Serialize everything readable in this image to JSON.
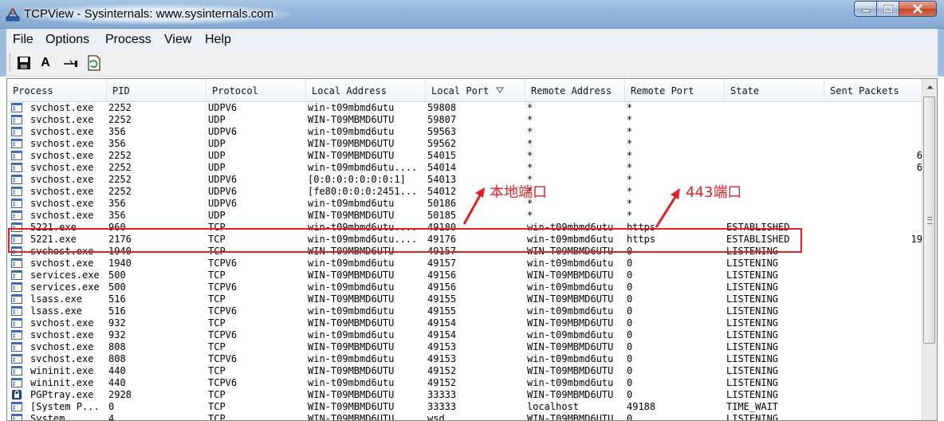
{
  "window": {
    "title": "TCPView - Sysinternals: www.sysinternals.com"
  },
  "menu": [
    "File",
    "Options",
    "Process",
    "View",
    "Help"
  ],
  "toolbar": {
    "icons": [
      "save-icon",
      "font-icon",
      "connect-icon",
      "refresh-icon"
    ],
    "font_label": "A"
  },
  "table": {
    "columns": [
      "Process",
      "PID",
      "Protocol",
      "Local Address",
      "Local Port",
      "Remote Address",
      "Remote Port",
      "State",
      "Sent Packets"
    ],
    "sort_column": "Local Port",
    "rows": [
      {
        "icon": "svc",
        "process": "svchost.exe",
        "pid": "2252",
        "protocol": "UDPV6",
        "local_address": "win-t09mbmd6utu",
        "local_port": "59808",
        "remote_address": "*",
        "remote_port": "*",
        "state": "",
        "sent": ""
      },
      {
        "icon": "svc",
        "process": "svchost.exe",
        "pid": "2252",
        "protocol": "UDP",
        "local_address": "WIN-T09MBMD6UTU",
        "local_port": "59807",
        "remote_address": "*",
        "remote_port": "*",
        "state": "",
        "sent": ""
      },
      {
        "icon": "svc",
        "process": "svchost.exe",
        "pid": "356",
        "protocol": "UDPV6",
        "local_address": "win-t09mbmd6utu",
        "local_port": "59563",
        "remote_address": "*",
        "remote_port": "*",
        "state": "",
        "sent": ""
      },
      {
        "icon": "svc",
        "process": "svchost.exe",
        "pid": "356",
        "protocol": "UDP",
        "local_address": "WIN-T09MBMD6UTU",
        "local_port": "59562",
        "remote_address": "*",
        "remote_port": "*",
        "state": "",
        "sent": ""
      },
      {
        "icon": "svc",
        "process": "svchost.exe",
        "pid": "2252",
        "protocol": "UDP",
        "local_address": "WIN-T09MBMD6UTU",
        "local_port": "54015",
        "remote_address": "*",
        "remote_port": "*",
        "state": "",
        "sent": "6"
      },
      {
        "icon": "svc",
        "process": "svchost.exe",
        "pid": "2252",
        "protocol": "UDP",
        "local_address": "win-t09mbmd6utu....",
        "local_port": "54014",
        "remote_address": "*",
        "remote_port": "*",
        "state": "",
        "sent": "6"
      },
      {
        "icon": "svc",
        "process": "svchost.exe",
        "pid": "2252",
        "protocol": "UDPV6",
        "local_address": "[0:0:0:0:0:0:0:1]",
        "local_port": "54013",
        "remote_address": "*",
        "remote_port": "*",
        "state": "",
        "sent": ""
      },
      {
        "icon": "svc",
        "process": "svchost.exe",
        "pid": "2252",
        "protocol": "UDPV6",
        "local_address": "[fe80:0:0:0:2451...",
        "local_port": "54012",
        "remote_address": "*",
        "remote_port": "*",
        "state": "",
        "sent": ""
      },
      {
        "icon": "svc",
        "process": "svchost.exe",
        "pid": "356",
        "protocol": "UDPV6",
        "local_address": "win-t09mbmd6utu",
        "local_port": "50186",
        "remote_address": "*",
        "remote_port": "*",
        "state": "",
        "sent": ""
      },
      {
        "icon": "svc",
        "process": "svchost.exe",
        "pid": "356",
        "protocol": "UDP",
        "local_address": "WIN-T09MBMD6UTU",
        "local_port": "50185",
        "remote_address": "*",
        "remote_port": "*",
        "state": "",
        "sent": ""
      },
      {
        "icon": "svc",
        "process": "5221.exe",
        "pid": "960",
        "protocol": "TCP",
        "local_address": "win-t09mbmd6utu....",
        "local_port": "49180",
        "remote_address": "win-t09mbmd6utu",
        "remote_port": "https",
        "state": "ESTABLISHED",
        "sent": ""
      },
      {
        "icon": "svc",
        "process": "5221.exe",
        "pid": "2176",
        "protocol": "TCP",
        "local_address": "win-t09mbmd6utu....",
        "local_port": "49176",
        "remote_address": "win-t09mbmd6utu",
        "remote_port": "https",
        "state": "ESTABLISHED",
        "sent": "19"
      },
      {
        "icon": "svc",
        "process": "svchost.exe",
        "pid": "1940",
        "protocol": "TCP",
        "local_address": "WIN-T09MBMD6UTU",
        "local_port": "49157",
        "remote_address": "WIN-T09MBMD6UTU",
        "remote_port": "0",
        "state": "LISTENING",
        "sent": ""
      },
      {
        "icon": "svc",
        "process": "svchost.exe",
        "pid": "1940",
        "protocol": "TCPV6",
        "local_address": "win-t09mbmd6utu",
        "local_port": "49157",
        "remote_address": "win-t09mbmd6utu",
        "remote_port": "0",
        "state": "LISTENING",
        "sent": ""
      },
      {
        "icon": "svc",
        "process": "services.exe",
        "pid": "500",
        "protocol": "TCP",
        "local_address": "WIN-T09MBMD6UTU",
        "local_port": "49156",
        "remote_address": "WIN-T09MBMD6UTU",
        "remote_port": "0",
        "state": "LISTENING",
        "sent": ""
      },
      {
        "icon": "svc",
        "process": "services.exe",
        "pid": "500",
        "protocol": "TCPV6",
        "local_address": "win-t09mbmd6utu",
        "local_port": "49156",
        "remote_address": "win-t09mbmd6utu",
        "remote_port": "0",
        "state": "LISTENING",
        "sent": ""
      },
      {
        "icon": "svc",
        "process": "lsass.exe",
        "pid": "516",
        "protocol": "TCP",
        "local_address": "WIN-T09MBMD6UTU",
        "local_port": "49155",
        "remote_address": "WIN-T09MBMD6UTU",
        "remote_port": "0",
        "state": "LISTENING",
        "sent": ""
      },
      {
        "icon": "svc",
        "process": "lsass.exe",
        "pid": "516",
        "protocol": "TCPV6",
        "local_address": "win-t09mbmd6utu",
        "local_port": "49155",
        "remote_address": "win-t09mbmd6utu",
        "remote_port": "0",
        "state": "LISTENING",
        "sent": ""
      },
      {
        "icon": "svc",
        "process": "svchost.exe",
        "pid": "932",
        "protocol": "TCP",
        "local_address": "WIN-T09MBMD6UTU",
        "local_port": "49154",
        "remote_address": "WIN-T09MBMD6UTU",
        "remote_port": "0",
        "state": "LISTENING",
        "sent": ""
      },
      {
        "icon": "svc",
        "process": "svchost.exe",
        "pid": "932",
        "protocol": "TCPV6",
        "local_address": "win-t09mbmd6utu",
        "local_port": "49154",
        "remote_address": "win-t09mbmd6utu",
        "remote_port": "0",
        "state": "LISTENING",
        "sent": ""
      },
      {
        "icon": "svc",
        "process": "svchost.exe",
        "pid": "808",
        "protocol": "TCP",
        "local_address": "WIN-T09MBMD6UTU",
        "local_port": "49153",
        "remote_address": "WIN-T09MBMD6UTU",
        "remote_port": "0",
        "state": "LISTENING",
        "sent": ""
      },
      {
        "icon": "svc",
        "process": "svchost.exe",
        "pid": "808",
        "protocol": "TCPV6",
        "local_address": "win-t09mbmd6utu",
        "local_port": "49153",
        "remote_address": "win-t09mbmd6utu",
        "remote_port": "0",
        "state": "LISTENING",
        "sent": ""
      },
      {
        "icon": "svc",
        "process": "wininit.exe",
        "pid": "440",
        "protocol": "TCP",
        "local_address": "WIN-T09MBMD6UTU",
        "local_port": "49152",
        "remote_address": "WIN-T09MBMD6UTU",
        "remote_port": "0",
        "state": "LISTENING",
        "sent": ""
      },
      {
        "icon": "svc",
        "process": "wininit.exe",
        "pid": "440",
        "protocol": "TCPV6",
        "local_address": "win-t09mbmd6utu",
        "local_port": "49152",
        "remote_address": "win-t09mbmd6utu",
        "remote_port": "0",
        "state": "LISTENING",
        "sent": ""
      },
      {
        "icon": "pgp",
        "process": "PGPtray.exe",
        "pid": "2928",
        "protocol": "TCP",
        "local_address": "WIN-T09MBMD6UTU",
        "local_port": "33333",
        "remote_address": "WIN-T09MBMD6UTU",
        "remote_port": "0",
        "state": "LISTENING",
        "sent": ""
      },
      {
        "icon": "svc",
        "process": "[System P...",
        "pid": "0",
        "protocol": "TCP",
        "local_address": "WIN-T09MBMD6UTU",
        "local_port": "33333",
        "remote_address": "localhost",
        "remote_port": "49188",
        "state": "TIME_WAIT",
        "sent": ""
      },
      {
        "icon": "svc",
        "process": "System",
        "pid": "4",
        "protocol": "TCP",
        "local_address": "WIN-T09MBMD6UTU",
        "local_port": "wsd",
        "remote_address": "WIN-T09MBMD6UTU",
        "remote_port": "0",
        "state": "LISTENING",
        "sent": ""
      }
    ]
  },
  "annotations": {
    "local_port": "本地端口",
    "remote_port": "443端口"
  },
  "colors": {
    "annotation": "#e21f26",
    "titlebar": "#95b7db"
  }
}
